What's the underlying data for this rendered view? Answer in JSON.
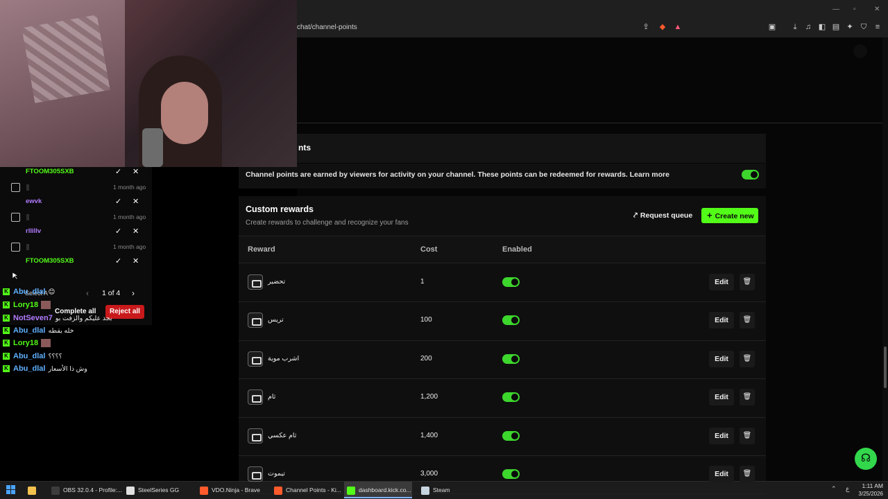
{
  "browser": {
    "url": "chat/channel-points"
  },
  "page": {
    "section_title": "nts",
    "points_description": "Channel points are earned by viewers for activity on your channel. These points can be redeemed for rewards. Learn more",
    "points_enabled": true,
    "custom_rewards": {
      "title": "Custom rewards",
      "subtitle": "Create rewards to challenge and recognize your fans",
      "request_queue_label": "Request queue",
      "create_new_label": "Create new"
    },
    "table": {
      "headers": {
        "reward": "Reward",
        "cost": "Cost",
        "enabled": "Enabled"
      },
      "edit_label": "Edit",
      "rows": [
        {
          "name": "تحضير",
          "cost": "1",
          "enabled": true
        },
        {
          "name": "تريس",
          "cost": "100",
          "enabled": true
        },
        {
          "name": "اشرب موية",
          "cost": "200",
          "enabled": true
        },
        {
          "name": "ثام",
          "cost": "1,200",
          "enabled": true
        },
        {
          "name": "ثام عكسي",
          "cost": "1,400",
          "enabled": true
        },
        {
          "name": "تيموت",
          "cost": "3,000",
          "enabled": true
        }
      ]
    }
  },
  "moderation": {
    "items": [
      {
        "user": "FTOOM305SXB",
        "user_color": "#53fc18",
        "time": "1 month ago"
      },
      {
        "user": "ewvk",
        "user_color": "#b27cff",
        "time": "1 month ago"
      },
      {
        "user": "rllillv",
        "user_color": "#b27cff",
        "time": "1 month ago"
      },
      {
        "user": "FTOOM305SXB",
        "user_color": "#53fc18",
        "time": ""
      }
    ],
    "select_all_label": "Select A",
    "pager": "1 of 4",
    "complete_all_label": "Complete all",
    "reject_all_label": "Reject all"
  },
  "chat": [
    {
      "user": "Abu_dlal",
      "color": "#5fb0ff",
      "message": "😊"
    },
    {
      "user": "Lory18",
      "color": "#53fc18",
      "message": ""
    },
    {
      "user": "NotSeven7",
      "color": "#b27cff",
      "message": "بجد عليكم والزفت بو"
    },
    {
      "user": "Abu_dlal",
      "color": "#5fb0ff",
      "message": "خله يقطه"
    },
    {
      "user": "Lory18",
      "color": "#53fc18",
      "message": ""
    },
    {
      "user": "Abu_dlal",
      "color": "#5fb0ff",
      "message": "؟؟؟؟"
    },
    {
      "user": "Abu_dlal",
      "color": "#5fb0ff",
      "message": "وش ذا الأسعار"
    }
  ],
  "taskbar": {
    "items": [
      {
        "label": "OBS 32.0.4 - Profile:...",
        "icon_color": "#3c3c3c"
      },
      {
        "label": "SteelSeries GG",
        "icon_color": "#e0e0e0"
      },
      {
        "label": "VDO.Ninja - Brave",
        "icon_color": "#ff5a2b"
      },
      {
        "label": "Channel Points - Ki...",
        "icon_color": "#ff5a2b"
      },
      {
        "label": "dashboard.kick.co...",
        "icon_color": "#53fc18"
      },
      {
        "label": "Steam",
        "icon_color": "#c7d5e0"
      }
    ],
    "time": "1:11 AM",
    "date": "3/25/2026",
    "lang": "ع"
  },
  "colors": {
    "accent": "#53fc18",
    "toggle": "#3dd62d",
    "reject": "#c8191b"
  }
}
